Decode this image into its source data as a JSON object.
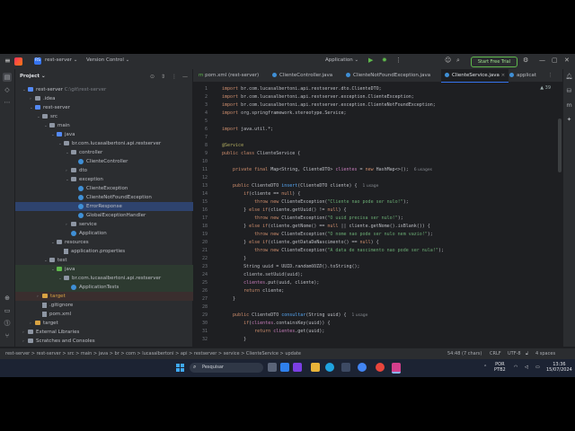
{
  "titlebar": {
    "project_badge": "RS",
    "project_name": "rest-server",
    "vcs": "Version Control",
    "run_config": "Application",
    "trial_button": "Start Free Trial"
  },
  "project_panel": {
    "title": "Project",
    "tree": [
      {
        "label": "rest-server",
        "hint": "C:\\git\\rest-server",
        "indent": 1,
        "type": "folder-blue",
        "open": true
      },
      {
        "label": ".idea",
        "indent": 2,
        "type": "folder",
        "open": false
      },
      {
        "label": "rest-server",
        "indent": 2,
        "type": "folder-blue",
        "open": true
      },
      {
        "label": "src",
        "indent": 3,
        "type": "folder",
        "open": true
      },
      {
        "label": "main",
        "indent": 4,
        "type": "folder",
        "open": true
      },
      {
        "label": "java",
        "indent": 5,
        "type": "folder-blue",
        "open": true
      },
      {
        "label": "br.com.lucasalbertoni.api.restserver",
        "indent": 6,
        "type": "folder",
        "open": true
      },
      {
        "label": "controller",
        "indent": 7,
        "type": "folder",
        "open": true
      },
      {
        "label": "ClienteController",
        "indent": 8,
        "type": "class"
      },
      {
        "label": "dto",
        "indent": 7,
        "type": "folder",
        "open": false
      },
      {
        "label": "exception",
        "indent": 7,
        "type": "folder",
        "open": true
      },
      {
        "label": "ClienteException",
        "indent": 8,
        "type": "class"
      },
      {
        "label": "ClienteNotFoundException",
        "indent": 8,
        "type": "class"
      },
      {
        "label": "ErrorResponse",
        "indent": 8,
        "type": "class",
        "selected": true
      },
      {
        "label": "GlobalExceptionHandler",
        "indent": 8,
        "type": "class"
      },
      {
        "label": "service",
        "indent": 7,
        "type": "folder",
        "open": false
      },
      {
        "label": "Application",
        "indent": 7,
        "type": "class"
      },
      {
        "label": "resources",
        "indent": 5,
        "type": "folder",
        "open": true
      },
      {
        "label": "application.properties",
        "indent": 6,
        "type": "file"
      },
      {
        "label": "test",
        "indent": 4,
        "type": "folder",
        "open": true
      },
      {
        "label": "java",
        "indent": 5,
        "type": "folder-green",
        "open": true,
        "test": true
      },
      {
        "label": "br.com.lucasalbertoni.api.restserver",
        "indent": 6,
        "type": "folder",
        "open": true,
        "test": true
      },
      {
        "label": "ApplicationTests",
        "indent": 7,
        "type": "class",
        "test": true
      },
      {
        "label": "target",
        "indent": 3,
        "type": "folder-orange",
        "open": false,
        "target": true
      },
      {
        "label": ".gitignore",
        "indent": 3,
        "type": "file"
      },
      {
        "label": "pom.xml",
        "indent": 3,
        "type": "file"
      },
      {
        "label": "target",
        "indent": 2,
        "type": "folder-orange",
        "open": false
      },
      {
        "label": "External Libraries",
        "indent": 1,
        "type": "folder",
        "open": false
      },
      {
        "label": "Scratches and Consoles",
        "indent": 1,
        "type": "folder",
        "open": false
      }
    ]
  },
  "tabs": [
    {
      "label": "pom.xml (rest-server)",
      "active": false
    },
    {
      "label": "ClienteController.java",
      "active": false
    },
    {
      "label": "ClienteNotFoundException.java",
      "active": false
    },
    {
      "label": "ClienteService.java",
      "active": true
    },
    {
      "label": "applicat",
      "active": false
    }
  ],
  "editor": {
    "inspections": "▲ 39",
    "lines": [
      {
        "n": "1",
        "html": "<span class='kw'>import</span> br.com.lucasalbertoni.api.restserver.dto.ClienteDTO;"
      },
      {
        "n": "2",
        "html": "<span class='kw'>import</span> br.com.lucasalbertoni.api.restserver.exception.ClienteException;"
      },
      {
        "n": "3",
        "html": "<span class='kw'>import</span> br.com.lucasalbertoni.api.restserver.exception.ClienteNotFoundException;"
      },
      {
        "n": "4",
        "html": "<span class='kw'>import</span> org.springframework.stereotype.Service;"
      },
      {
        "n": "5",
        "html": ""
      },
      {
        "n": "6",
        "html": "<span class='kw'>import</span> java.util.*;"
      },
      {
        "n": "7",
        "html": ""
      },
      {
        "n": "8",
        "html": "<span class='ann'>@Service</span>"
      },
      {
        "n": "9",
        "html": "<span class='kw'>public class</span> ClienteService {"
      },
      {
        "n": "10",
        "html": ""
      },
      {
        "n": "11",
        "html": "    <span class='kw'>private final</span> Map&lt;String, ClienteDTO&gt; <span class='fld'>clientes</span> = <span class='kw'>new</span> HashMap&lt;&gt;();  <span class='inlay'>6 usages</span>"
      },
      {
        "n": "12",
        "html": ""
      },
      {
        "n": "13",
        "html": "    <span class='kw'>public</span> ClienteDTO <span class='mth'>insert</span>(ClienteDTO cliente) {  <span class='inlay'>1 usage</span>"
      },
      {
        "n": "14",
        "html": "        <span class='kw'>if</span>(cliente == <span class='kw'>null</span>) {"
      },
      {
        "n": "15",
        "html": "            <span class='kw'>throw new</span> ClienteException(<span class='str'>\"Cliente nao pode ser nulo!\"</span>);"
      },
      {
        "n": "16",
        "html": "        } <span class='kw'>else if</span>(cliente.getUuid() != <span class='kw'>null</span>) {"
      },
      {
        "n": "17",
        "html": "            <span class='kw'>throw new</span> ClienteException(<span class='str'>\"O uuid precisa ser nulo!\"</span>);"
      },
      {
        "n": "18",
        "html": "        } <span class='kw'>else if</span>(cliente.getNome() == <span class='kw'>null</span> || cliente.getNome().isBlank()) {"
      },
      {
        "n": "19",
        "html": "            <span class='kw'>throw new</span> ClienteException(<span class='str'>\"O nome nao pode ser nulo nem vazio!\"</span>);"
      },
      {
        "n": "20",
        "html": "        } <span class='kw'>else if</span>(cliente.getDataDeNascimento() == <span class='kw'>null</span>) {"
      },
      {
        "n": "21",
        "html": "            <span class='kw'>throw new</span> ClienteException(<span class='str'>\"A data de nascimento nao pode ser nula!\"</span>);"
      },
      {
        "n": "22",
        "html": "        }"
      },
      {
        "n": "23",
        "html": "        String uuid = UUID.<i>randomUUID</i>().toString();"
      },
      {
        "n": "24",
        "html": "        cliente.setUuid(uuid);"
      },
      {
        "n": "25",
        "html": "        <span class='fld'>clientes</span>.put(uuid, cliente);"
      },
      {
        "n": "26",
        "html": "        <span class='kw'>return</span> cliente;"
      },
      {
        "n": "27",
        "html": "    }"
      },
      {
        "n": "28",
        "html": ""
      },
      {
        "n": "29",
        "html": "    <span class='kw'>public</span> ClienteDTO <span class='mth'>consultar</span>(String uuid) {  <span class='inlay'>1 usage</span>"
      },
      {
        "n": "30",
        "html": "        <span class='kw'>if</span>(<span class='fld'>clientes</span>.containsKey(uuid)) {"
      },
      {
        "n": "31",
        "html": "            <span class='kw'>return</span> <span class='fld'>clientes</span>.get(uuid);"
      },
      {
        "n": "32",
        "html": "        }"
      }
    ]
  },
  "statusbar": {
    "breadcrumb": "rest-server > rest-server > src > main > java > br > com > lucasalbertoni > api > restserver > service > ClienteService > update",
    "position": "54:48 (7 chars)",
    "line_sep": "CRLF",
    "encoding": "UTF-8",
    "indent": "4 spaces"
  },
  "taskbar": {
    "search_placeholder": "Pesquisar",
    "lang_top": "POR",
    "lang_bottom": "PTB2",
    "time": "13:36",
    "date": "15/07/2024"
  }
}
